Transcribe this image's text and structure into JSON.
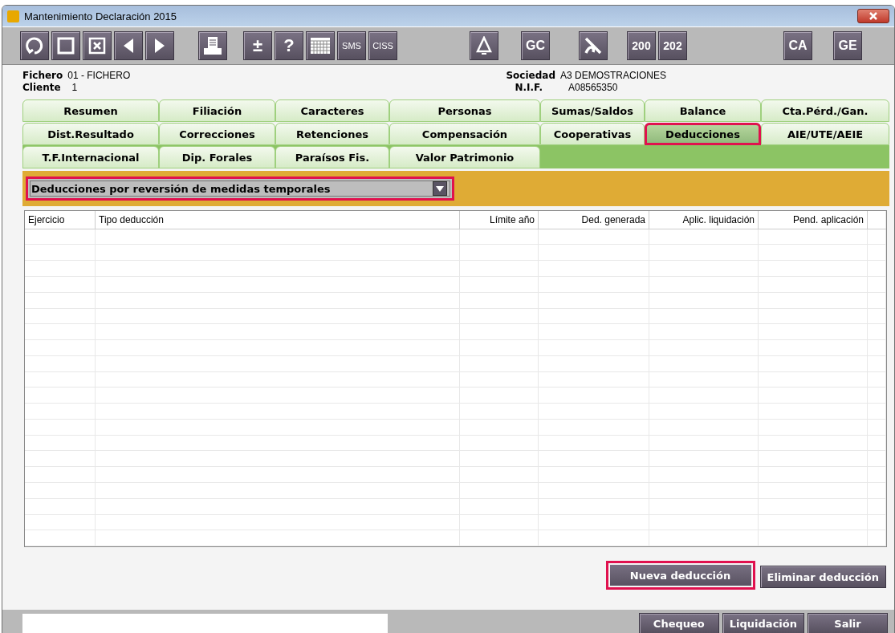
{
  "window": {
    "title": "Mantenimiento Declaración 2015"
  },
  "toolbar": {
    "groups": [
      [
        {
          "kind": "refresh"
        },
        {
          "kind": "square"
        },
        {
          "kind": "xbox"
        },
        {
          "kind": "left"
        },
        {
          "kind": "right"
        }
      ],
      [
        {
          "kind": "printer"
        }
      ],
      [
        {
          "kind": "text",
          "label": "±"
        },
        {
          "kind": "text",
          "label": "?"
        },
        {
          "kind": "calendar"
        },
        {
          "kind": "small",
          "label": "SMS"
        },
        {
          "kind": "small",
          "label": "CISS"
        }
      ],
      [
        {
          "kind": "bell"
        }
      ],
      [
        {
          "kind": "text",
          "label": "GC"
        }
      ],
      [
        {
          "kind": "pen"
        }
      ],
      [
        {
          "kind": "text",
          "label": "200"
        },
        {
          "kind": "text",
          "label": "202"
        }
      ],
      [
        {
          "kind": "text",
          "label": "CA"
        }
      ],
      [
        {
          "kind": "text",
          "label": "GE"
        }
      ]
    ]
  },
  "info": {
    "fichero_label": "Fichero",
    "fichero": "01 - FICHERO",
    "cliente_label": "Cliente",
    "cliente": "1",
    "sociedad_label": "Sociedad",
    "sociedad": "A3 DEMOSTRACIONES",
    "nif_label": "N.I.F.",
    "nif": "A08565350"
  },
  "tab_rows": [
    [
      {
        "label": "Resumen",
        "selected": false
      },
      {
        "label": "Filiación",
        "selected": false
      },
      {
        "label": "Caracteres",
        "selected": false
      },
      {
        "label": "Personas",
        "selected": false
      },
      {
        "label": "Sumas/Saldos",
        "selected": false
      },
      {
        "label": "Balance",
        "selected": false
      },
      {
        "label": "Cta.Pérd./Gan.",
        "selected": false
      }
    ],
    [
      {
        "label": "Dist.Resultado",
        "selected": false
      },
      {
        "label": "Correcciones",
        "selected": false
      },
      {
        "label": "Retenciones",
        "selected": false
      },
      {
        "label": "Compensación",
        "selected": false
      },
      {
        "label": "Cooperativas",
        "selected": false
      },
      {
        "label": "Deducciones",
        "selected": true
      },
      {
        "label": "AIE/UTE/AEIE",
        "selected": false
      }
    ],
    [
      {
        "label": "T.F.Internacional",
        "selected": false
      },
      {
        "label": "Dip. Forales",
        "selected": false
      },
      {
        "label": "Paraísos Fis.",
        "selected": false
      },
      {
        "label": "Valor Patrimonio",
        "selected": false
      }
    ]
  ],
  "dropdown": {
    "value": "Deducciones por reversión de medidas temporales",
    "highlighted": true
  },
  "table": {
    "columns": [
      "Ejercicio",
      "Tipo deducción",
      "Límite año",
      "Ded. generada",
      "Aplic. liquidación",
      "Pend. aplicación"
    ]
  },
  "actions": [
    {
      "label": "Nueva deducción",
      "highlighted": true
    },
    {
      "label": "Eliminar deducción",
      "highlighted": false
    }
  ],
  "footer_buttons": [
    {
      "label": "Chequeo"
    },
    {
      "label": "Liquidación"
    },
    {
      "label": "Salir"
    }
  ]
}
